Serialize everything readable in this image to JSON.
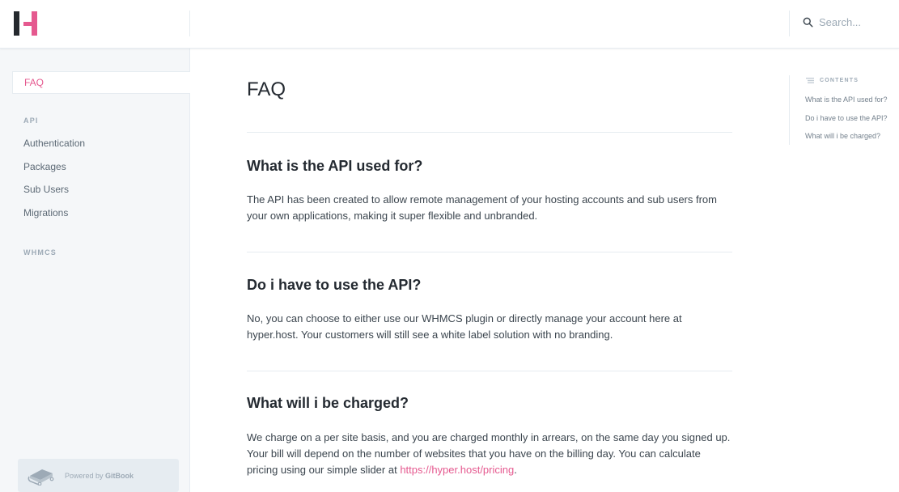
{
  "header": {
    "logo_alt": "Hyper Host",
    "search_placeholder": "Search...",
    "search_icon": "search-icon"
  },
  "sidebar": {
    "active_item": "FAQ",
    "sections": [
      {
        "header": "API",
        "items": [
          "Authentication",
          "Packages",
          "Sub Users",
          "Migrations"
        ]
      },
      {
        "header": "WHMCS",
        "items": []
      }
    ],
    "footer": {
      "prefix": "Powered by ",
      "brand": "GitBook",
      "icon": "book-icon"
    }
  },
  "main": {
    "title": "FAQ",
    "sections": [
      {
        "heading": "What is the API used for?",
        "body": "The API has been created to allow remote management of your hosting accounts and sub users from your own applications, making it super flexible and unbranded."
      },
      {
        "heading": "Do i have to use the API?",
        "body": "No, you can choose to either use our WHMCS plugin or directly manage your account here at hyper.host. Your customers will still see a white label solution with no branding."
      },
      {
        "heading": "What will i be charged?",
        "body": "We charge on a per site basis, and you are charged monthly in arrears, on the same day you signed up. Your bill will depend on the number of websites that you have on the billing day. You can calculate pricing using our simple slider at ",
        "link": "https://hyper.host/pricing",
        "suffix": "."
      }
    ]
  },
  "toc": {
    "header": "CONTENTS",
    "items": [
      "What is the API used for?",
      "Do i have to use the API?",
      "What will i be charged?"
    ]
  },
  "colors": {
    "accent": "#e5598f",
    "text": "#242a31",
    "muted": "#9daab6",
    "sidebar_bg": "#f5f7f9",
    "border": "#e6ecf1"
  }
}
